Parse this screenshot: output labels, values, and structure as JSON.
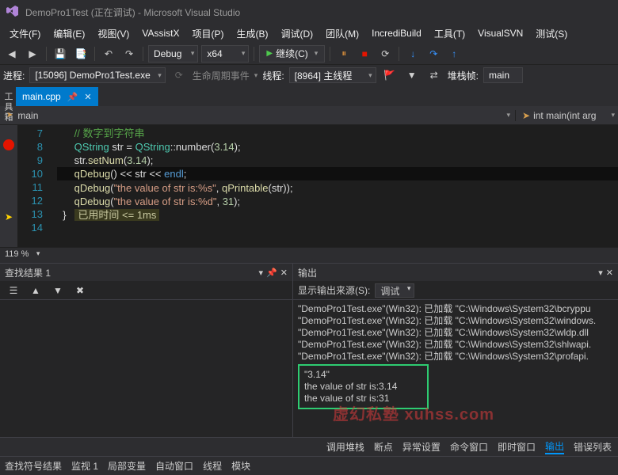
{
  "titlebar": {
    "title": "DemoPro1Test (正在调试) - Microsoft Visual Studio"
  },
  "menubar": [
    "文件(F)",
    "编辑(E)",
    "视图(V)",
    "VAssistX",
    "项目(P)",
    "生成(B)",
    "调试(D)",
    "团队(M)",
    "IncrediBuild",
    "工具(T)",
    "VisualSVN",
    "测试(S)"
  ],
  "toolbar": {
    "config": "Debug",
    "platform": "x64",
    "continue": "继续(C)"
  },
  "debugbar": {
    "process_label": "进程:",
    "process": "[15096] DemoPro1Test.exe",
    "lifecycle": "生命周期事件",
    "thread_label": "线程:",
    "thread": "[8964] 主线程",
    "stack_label": "堆栈帧:",
    "stack": "main"
  },
  "tab": {
    "name": "main.cpp"
  },
  "nav": {
    "left": "main",
    "right": "int main(int arg"
  },
  "editor": {
    "lines": [
      7,
      8,
      9,
      10,
      11,
      12,
      13,
      14
    ],
    "comment": "// 数字到字符串",
    "l8_type": "QString",
    "l8_var": " str = ",
    "l8_type2": "QString",
    "l8_call": "::number(",
    "l8_num": "3.14",
    "l8_end": ");",
    "l9_pre": "str.",
    "l9_fn": "setNum",
    "l9_op": "(",
    "l9_num": "3.14",
    "l9_end": ");",
    "l10_fn": "qDebug",
    "l10_rest": "() << str << ",
    "l10_kw": "endl",
    "l10_end": ";",
    "l11_fn": "qDebug",
    "l11_op": "(",
    "l11_str": "\"the value of str is:%s\"",
    "l11_mid": ", ",
    "l11_call": "qPrintable",
    "l11_end": "(str));",
    "l12_fn": "qDebug",
    "l12_op": "(",
    "l12_str": "\"the value of str is:%d\"",
    "l12_mid": ", ",
    "l12_num": "31",
    "l12_end": ");",
    "l13_brace": "}",
    "l13_time": "已用时间 <= 1ms"
  },
  "zoom": "119 %",
  "find_panel": {
    "title": "查找结果 1"
  },
  "output_panel": {
    "title": "输出",
    "src_label": "显示输出来源(S):",
    "src": "调试",
    "lines_top": [
      "\"DemoPro1Test.exe\"(Win32): 已加载 \"C:\\Windows\\System32\\bcryppu",
      "\"DemoPro1Test.exe\"(Win32): 已加载 \"C:\\Windows\\System32\\windows.",
      "\"DemoPro1Test.exe\"(Win32): 已加载 \"C:\\Windows\\System32\\wldp.dll",
      "\"DemoPro1Test.exe\"(Win32): 已加载 \"C:\\Windows\\System32\\shlwapi.",
      "\"DemoPro1Test.exe\"(Win32): 已加载 \"C:\\Windows\\System32\\profapi."
    ],
    "boxed": [
      "\"3.14\"",
      "",
      "the value of str is:3.14",
      "the value of str is:31"
    ]
  },
  "bottom_tabs_right": [
    "调用堆栈",
    "断点",
    "异常设置",
    "命令窗口",
    "即时窗口",
    "输出",
    "错误列表"
  ],
  "bottom_tabs_left": [
    "查找符号结果",
    "监视 1",
    "局部变量",
    "自动窗口",
    "线程",
    "模块"
  ],
  "side": "工具箱",
  "watermark": "虚幻私塾  xuhss.com"
}
